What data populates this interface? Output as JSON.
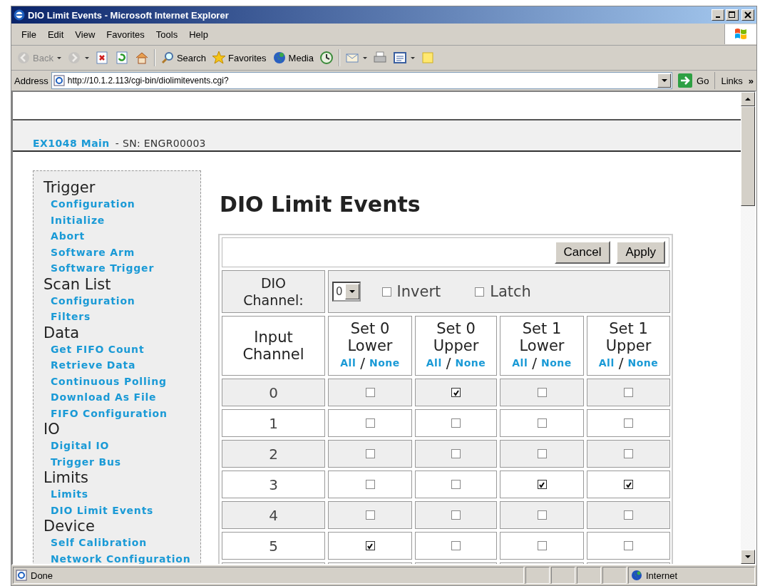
{
  "window": {
    "title": "DIO Limit Events - Microsoft Internet Explorer"
  },
  "menu": [
    "File",
    "Edit",
    "View",
    "Favorites",
    "Tools",
    "Help"
  ],
  "toolbar": [
    {
      "kind": "back",
      "label": "Back",
      "dropdown": true,
      "disabled": true
    },
    {
      "kind": "forward",
      "dropdown": true,
      "disabled": true
    },
    {
      "kind": "stop",
      "dropdown": false,
      "disabled": false
    },
    {
      "kind": "refresh",
      "dropdown": false,
      "disabled": false
    },
    {
      "kind": "home",
      "dropdown": false,
      "disabled": false
    },
    {
      "kind": "search",
      "label": "Search",
      "dropdown": false,
      "disabled": false
    },
    {
      "kind": "favorites",
      "label": "Favorites",
      "dropdown": false,
      "disabled": false
    },
    {
      "kind": "media",
      "label": "Media",
      "dropdown": false,
      "disabled": false
    },
    {
      "kind": "history",
      "dropdown": false,
      "disabled": false
    },
    {
      "kind": "mail",
      "dropdown": true,
      "disabled": false
    },
    {
      "kind": "print",
      "dropdown": false,
      "disabled": false
    },
    {
      "kind": "edit",
      "dropdown": true,
      "disabled": false
    },
    {
      "kind": "note",
      "dropdown": false,
      "disabled": false
    }
  ],
  "address": {
    "label": "Address",
    "value": "http://10.1.2.113/cgi-bin/diolimitevents.cgi?",
    "go": "Go",
    "links": "Links",
    "more": "»"
  },
  "page": {
    "device_link": "EX1048 Main",
    "serial": "- SN: ENGR00003",
    "sidebar": [
      {
        "heading": "Trigger",
        "items": [
          "Configuration",
          "Initialize",
          "Abort",
          "Software Arm",
          "Software Trigger"
        ]
      },
      {
        "heading": "Scan List",
        "items": [
          "Configuration",
          "Filters"
        ]
      },
      {
        "heading": "Data",
        "items": [
          "Get FIFO Count",
          "Retrieve Data",
          "Continuous Polling",
          "Download As File",
          "FIFO Configuration"
        ]
      },
      {
        "heading": "IO",
        "items": [
          "Digital IO",
          "Trigger Bus"
        ]
      },
      {
        "heading": "Limits",
        "items": [
          "Limits",
          "DIO Limit Events"
        ]
      },
      {
        "heading": "Device",
        "items": [
          "Self Calibration",
          "Network Configuration"
        ]
      }
    ],
    "title": "DIO Limit Events",
    "buttons": [
      "Cancel",
      "Apply"
    ],
    "dio_channel": {
      "label": "DIO Channel:",
      "value": "0"
    },
    "options": [
      {
        "label": "Invert",
        "checked": false
      },
      {
        "label": "Latch",
        "checked": false
      }
    ],
    "first_column": "Input Channel",
    "columns": [
      {
        "title": "Set 0 Lower",
        "all": "All",
        "sep": "/",
        "none": "None"
      },
      {
        "title": "Set 0 Upper",
        "all": "All",
        "sep": "/",
        "none": "None"
      },
      {
        "title": "Set 1 Lower",
        "all": "All",
        "sep": "/",
        "none": "None"
      },
      {
        "title": "Set 1 Upper",
        "all": "All",
        "sep": "/",
        "none": "None"
      }
    ],
    "rows": [
      {
        "channel": "0",
        "checked": [
          false,
          true,
          false,
          false
        ]
      },
      {
        "channel": "1",
        "checked": [
          false,
          false,
          false,
          false
        ]
      },
      {
        "channel": "2",
        "checked": [
          false,
          false,
          false,
          false
        ]
      },
      {
        "channel": "3",
        "checked": [
          false,
          false,
          true,
          true
        ]
      },
      {
        "channel": "4",
        "checked": [
          false,
          false,
          false,
          false
        ]
      },
      {
        "channel": "5",
        "checked": [
          true,
          false,
          false,
          false
        ]
      }
    ]
  },
  "status": {
    "text": "Done",
    "zone": "Internet"
  }
}
